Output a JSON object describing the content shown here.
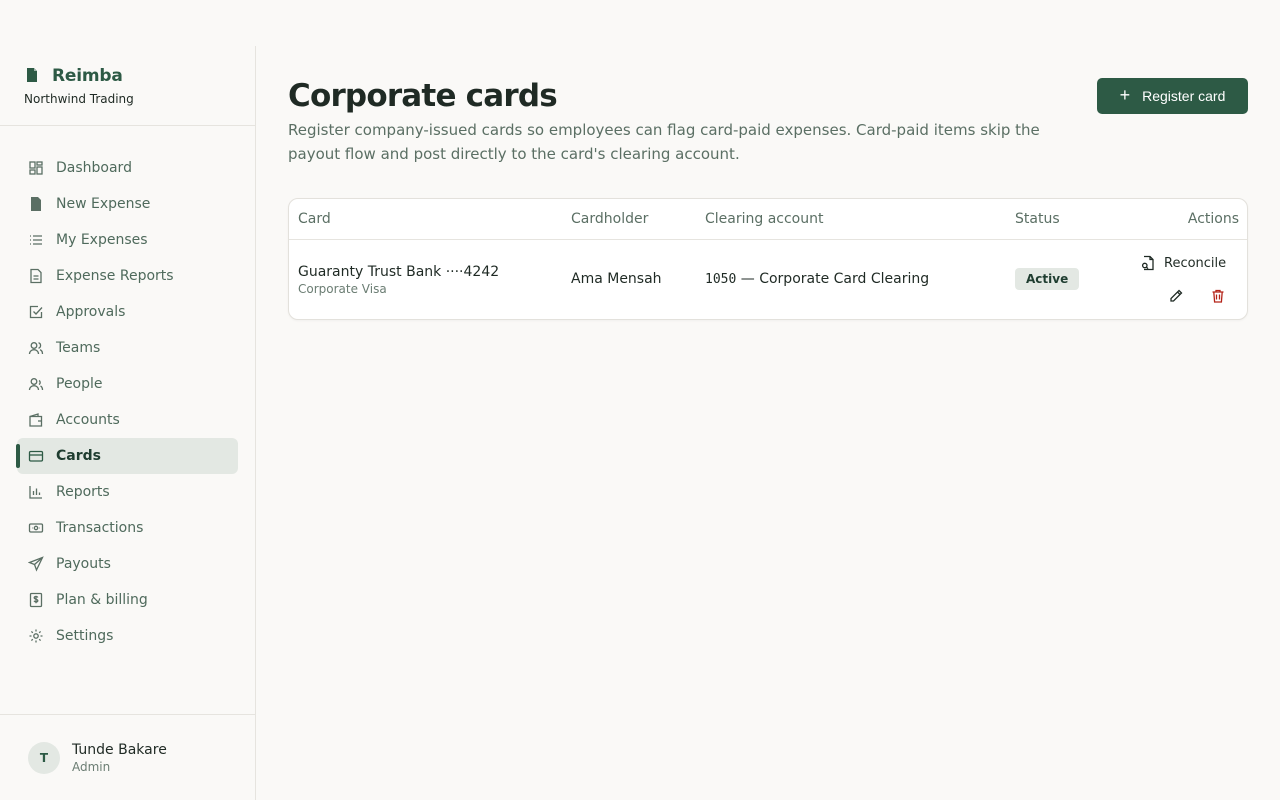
{
  "brand": {
    "name": "Reimba",
    "org": "Northwind Trading"
  },
  "sidebar": {
    "items": [
      {
        "label": "Dashboard",
        "icon": "dashboard-icon"
      },
      {
        "label": "New Expense",
        "icon": "file-icon"
      },
      {
        "label": "My Expenses",
        "icon": "list-icon"
      },
      {
        "label": "Expense Reports",
        "icon": "report-icon"
      },
      {
        "label": "Approvals",
        "icon": "check-square-icon"
      },
      {
        "label": "Teams",
        "icon": "users-icon"
      },
      {
        "label": "People",
        "icon": "people-icon"
      },
      {
        "label": "Accounts",
        "icon": "wallet-icon"
      },
      {
        "label": "Cards",
        "icon": "credit-card-icon",
        "active": true
      },
      {
        "label": "Reports",
        "icon": "bar-chart-icon"
      },
      {
        "label": "Transactions",
        "icon": "banknote-icon"
      },
      {
        "label": "Payouts",
        "icon": "send-icon"
      },
      {
        "label": "Plan & billing",
        "icon": "dollar-receipt-icon"
      },
      {
        "label": "Settings",
        "icon": "gear-icon"
      }
    ]
  },
  "user": {
    "initial": "T",
    "name": "Tunde Bakare",
    "role": "Admin"
  },
  "page": {
    "title": "Corporate cards",
    "description": "Register company-issued cards so employees can flag card-paid expenses. Card-paid items skip the payout flow and post directly to the card's clearing account.",
    "register_label": "Register card"
  },
  "table": {
    "headers": {
      "card": "Card",
      "cardholder": "Cardholder",
      "clearing": "Clearing account",
      "status": "Status",
      "actions": "Actions"
    },
    "rows": [
      {
        "card_name": "Guaranty Trust Bank ····4242",
        "card_type": "Corporate Visa",
        "cardholder": "Ama Mensah",
        "account_code": "1050",
        "account_name": " — Corporate Card Clearing",
        "status": "Active",
        "reconcile_label": "Reconcile"
      }
    ]
  },
  "colors": {
    "accent": "#2d5a45",
    "danger": "#b42318",
    "active_bg": "#e3e8e3"
  }
}
